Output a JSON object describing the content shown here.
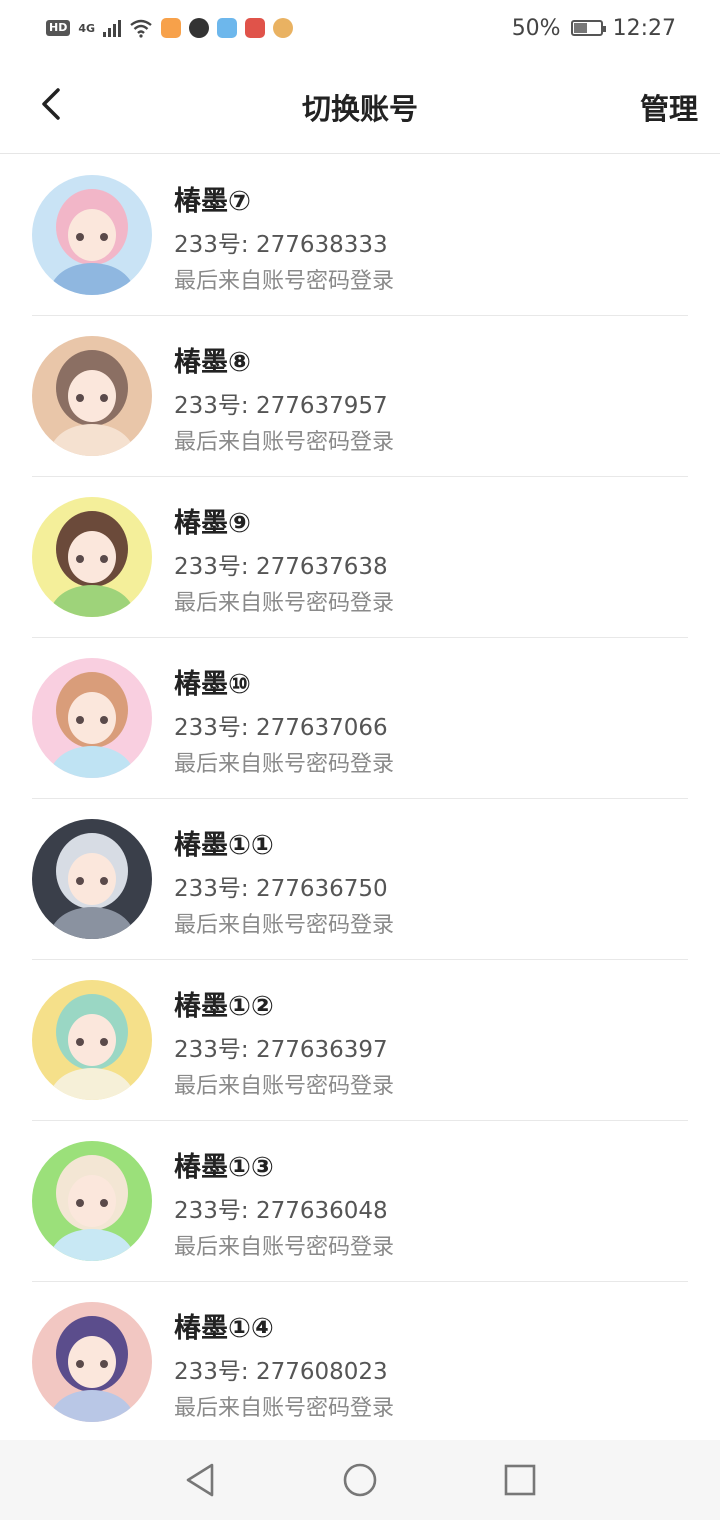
{
  "status_bar": {
    "hd_label": "HD",
    "network_label": "4G",
    "battery_percent": "50%",
    "battery_level": 0.5,
    "time": "12:27"
  },
  "header": {
    "title": "切换账号",
    "manage_label": "管理"
  },
  "accounts": [
    {
      "name": "椿墨⑦",
      "id_line": "233号: 277638333",
      "last_login": "最后来自账号密码登录",
      "avatar_colors": [
        "#c9e3f5",
        "#f2b6c8",
        "#8fb7e0"
      ]
    },
    {
      "name": "椿墨⑧",
      "id_line": "233号: 277637957",
      "last_login": "最后来自账号密码登录",
      "avatar_colors": [
        "#e9c6a9",
        "#8b6f63",
        "#f5e1d0"
      ]
    },
    {
      "name": "椿墨⑨",
      "id_line": "233号: 277637638",
      "last_login": "最后来自账号密码登录",
      "avatar_colors": [
        "#f4ef9a",
        "#6b4a3a",
        "#9ed37a"
      ]
    },
    {
      "name": "椿墨⑩",
      "id_line": "233号: 277637066",
      "last_login": "最后来自账号密码登录",
      "avatar_colors": [
        "#f9cfe0",
        "#d99d7a",
        "#bfe3f3"
      ]
    },
    {
      "name": "椿墨①①",
      "id_line": "233号: 277636750",
      "last_login": "最后来自账号密码登录",
      "avatar_colors": [
        "#3a3f4a",
        "#d7dce4",
        "#8a92a0"
      ]
    },
    {
      "name": "椿墨①②",
      "id_line": "233号: 277636397",
      "last_login": "最后来自账号密码登录",
      "avatar_colors": [
        "#f5e08a",
        "#9ad7c4",
        "#f6f0d8"
      ]
    },
    {
      "name": "椿墨①③",
      "id_line": "233号: 277636048",
      "last_login": "最后来自账号密码登录",
      "avatar_colors": [
        "#9be07a",
        "#f3e6d4",
        "#c8e8f4"
      ]
    },
    {
      "name": "椿墨①④",
      "id_line": "233号: 277608023",
      "last_login": "最后来自账号密码登录",
      "avatar_colors": [
        "#f2c7c2",
        "#5b4d8c",
        "#b9c7e6"
      ]
    }
  ]
}
